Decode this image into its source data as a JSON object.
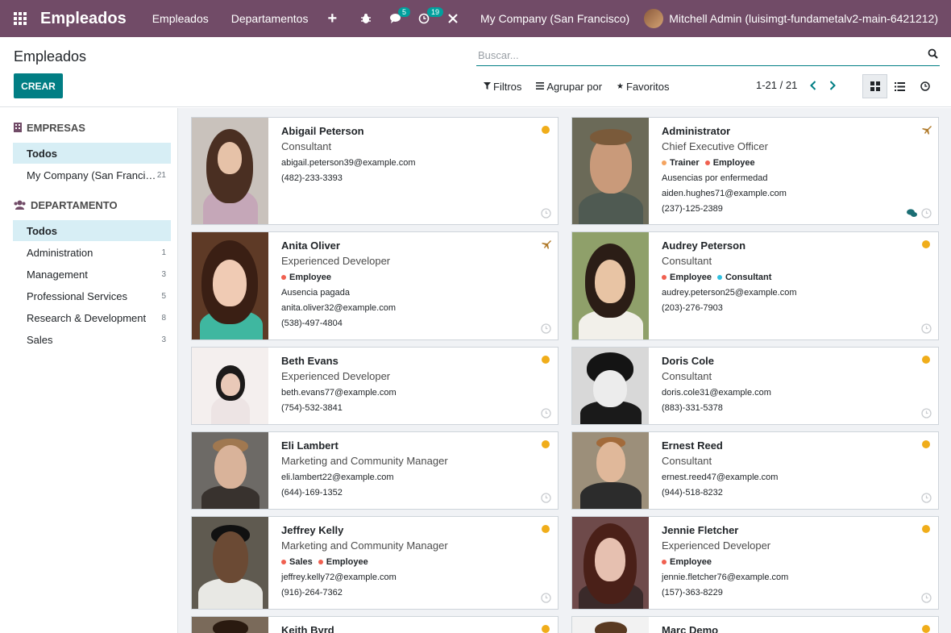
{
  "navbar": {
    "app_title": "Empleados",
    "menus": [
      "Empleados",
      "Departamentos"
    ],
    "messages_badge": "5",
    "activity_badge": "19",
    "company": "My Company (San Francisco)",
    "user": "Mitchell Admin (luisimgt-fundametalv2-main-6421212)",
    "color": "#714b67"
  },
  "control": {
    "breadcrumb": "Empleados",
    "create_label": "CREAR",
    "search_placeholder": "Buscar...",
    "filters": "Filtros",
    "group_by": "Agrupar por",
    "favorites": "Favoritos",
    "pager": "1-21 / 21"
  },
  "sidebar": {
    "companies_header": "EMPRESAS",
    "companies": [
      {
        "label": "Todos",
        "count": ""
      },
      {
        "label": "My Company (San Franci…",
        "count": "21"
      }
    ],
    "departments_header": "DEPARTAMENTO",
    "departments": [
      {
        "label": "Todos",
        "count": ""
      },
      {
        "label": "Administration",
        "count": "1"
      },
      {
        "label": "Management",
        "count": "3"
      },
      {
        "label": "Professional Services",
        "count": "5"
      },
      {
        "label": "Research & Development",
        "count": "8"
      },
      {
        "label": "Sales",
        "count": "3"
      }
    ]
  },
  "employees": [
    {
      "name": "Abigail Peterson",
      "job": "Consultant",
      "email": "abigail.peterson39@example.com",
      "phone": "(482)-233-3393"
    },
    {
      "name": "Administrator",
      "job": "Chief Executive Officer",
      "tag1": "Trainer",
      "tag2": "Employee",
      "absence": "Ausencias por enfermedad",
      "email": "aiden.hughes71@example.com",
      "phone": "(237)-125-2389"
    },
    {
      "name": "Anita Oliver",
      "job": "Experienced Developer",
      "tag1": "Employee",
      "absence": "Ausencia pagada",
      "email": "anita.oliver32@example.com",
      "phone": "(538)-497-4804"
    },
    {
      "name": "Audrey Peterson",
      "job": "Consultant",
      "tag1": "Employee",
      "tag2": "Consultant",
      "email": "audrey.peterson25@example.com",
      "phone": "(203)-276-7903"
    },
    {
      "name": "Beth Evans",
      "job": "Experienced Developer",
      "email": "beth.evans77@example.com",
      "phone": "(754)-532-3841"
    },
    {
      "name": "Doris Cole",
      "job": "Consultant",
      "email": "doris.cole31@example.com",
      "phone": "(883)-331-5378"
    },
    {
      "name": "Eli Lambert",
      "job": "Marketing and Community Manager",
      "email": "eli.lambert22@example.com",
      "phone": "(644)-169-1352"
    },
    {
      "name": "Ernest Reed",
      "job": "Consultant",
      "email": "ernest.reed47@example.com",
      "phone": "(944)-518-8232"
    },
    {
      "name": "Jeffrey Kelly",
      "job": "Marketing and Community Manager",
      "tag1": "Sales",
      "tag2": "Employee",
      "email": "jeffrey.kelly72@example.com",
      "phone": "(916)-264-7362"
    },
    {
      "name": "Jennie Fletcher",
      "job": "Experienced Developer",
      "tag1": "Employee",
      "email": "jennie.fletcher76@example.com",
      "phone": "(157)-363-8229"
    },
    {
      "name": "Keith Byrd"
    },
    {
      "name": "Marc Demo"
    }
  ],
  "colors": {
    "primary": "#017e84",
    "present": "#f0ad1a",
    "tag_orange": "#f4a460",
    "tag_red": "#f06050",
    "tag_cyan": "#30c0e0"
  }
}
